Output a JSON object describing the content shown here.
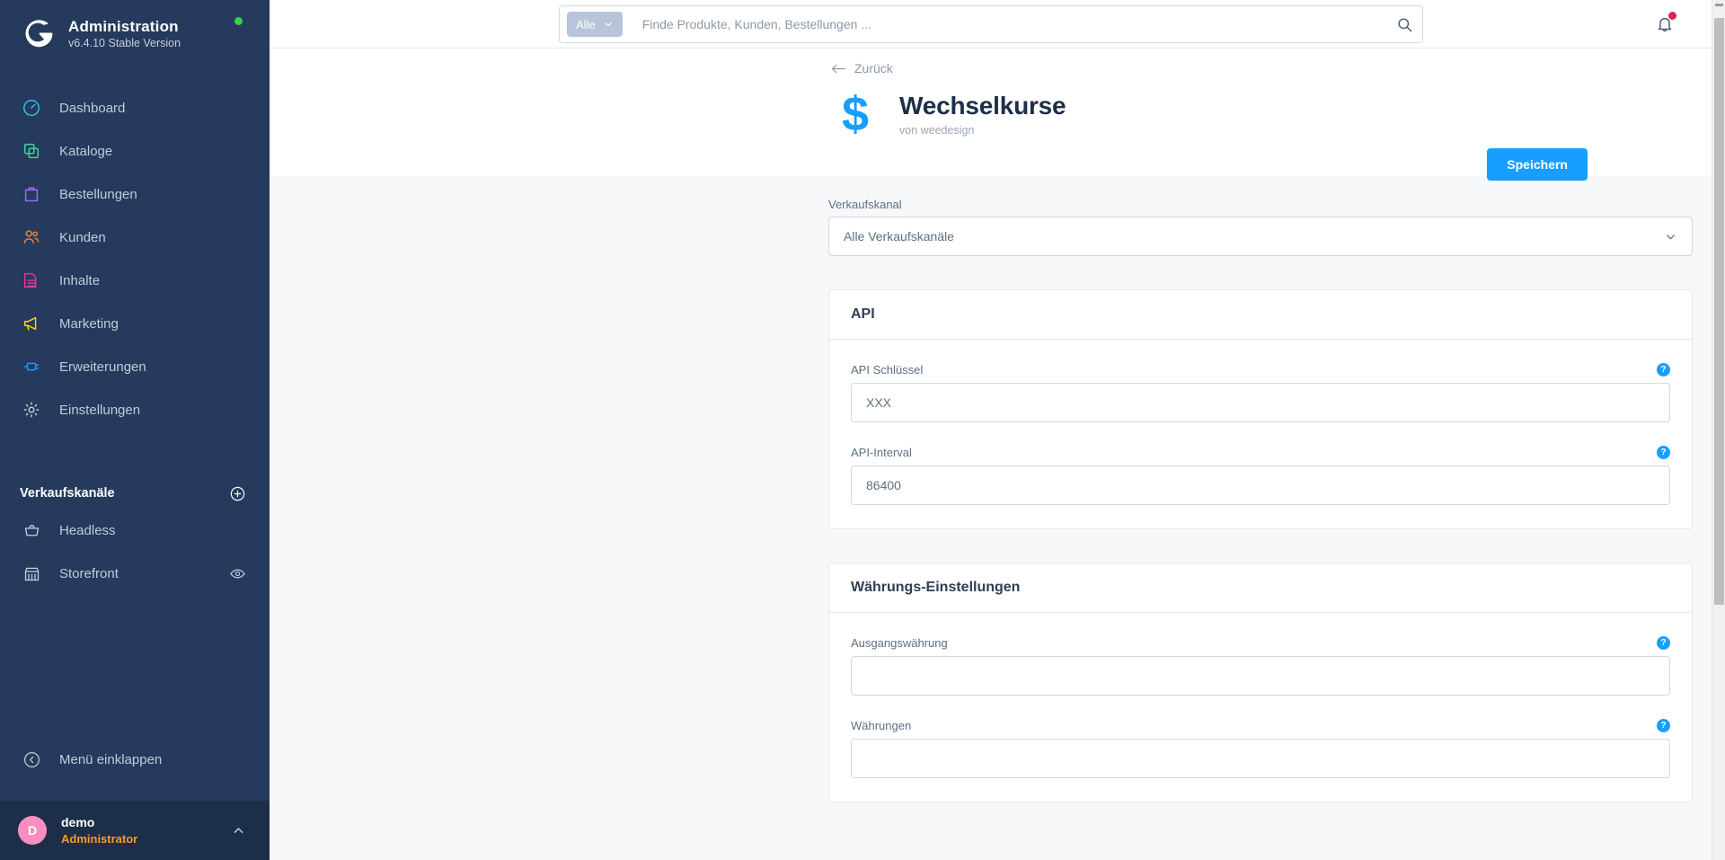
{
  "sidebar": {
    "brand": {
      "title": "Administration",
      "version": "v6.4.10 Stable Version"
    },
    "nav": [
      {
        "label": "Dashboard",
        "icon": "speedometer-icon",
        "color": "#37BFE8"
      },
      {
        "label": "Kataloge",
        "icon": "catalog-icon",
        "color": "#3FD69E"
      },
      {
        "label": "Bestellungen",
        "icon": "bag-icon",
        "color": "#9B6EF3"
      },
      {
        "label": "Kunden",
        "icon": "users-icon",
        "color": "#F1852F"
      },
      {
        "label": "Inhalte",
        "icon": "content-icon",
        "color": "#F0319B"
      },
      {
        "label": "Marketing",
        "icon": "megaphone-icon",
        "color": "#F7D117"
      },
      {
        "label": "Erweiterungen",
        "icon": "plugin-icon",
        "color": "#189EFF"
      },
      {
        "label": "Einstellungen",
        "icon": "gear-icon",
        "color": "#C5CEDC"
      }
    ],
    "sales_channels": {
      "title": "Verkaufskanäle",
      "add_label": "+",
      "items": [
        {
          "label": "Headless",
          "icon": "basket-icon",
          "has_eye": false
        },
        {
          "label": "Storefront",
          "icon": "storefront-icon",
          "has_eye": true
        }
      ]
    },
    "collapse_label": "Menü einklappen",
    "user": {
      "initial": "D",
      "name": "demo",
      "role": "Administrator"
    }
  },
  "topbar": {
    "scope_label": "Alle",
    "search_placeholder": "Finde Produkte, Kunden, Bestellungen ...",
    "search_value": ""
  },
  "header": {
    "back_label": "Zurück",
    "app_symbol": "$",
    "title": "Wechselkurse",
    "subtitle": "von weedesign",
    "save_label": "Speichern"
  },
  "main": {
    "sales_channel": {
      "label": "Verkaufskanal",
      "value": "Alle Verkaufskanäle"
    },
    "cards": [
      {
        "title": "API",
        "fields": [
          {
            "label": "API Schlüssel",
            "value": "XXX",
            "help": "?"
          },
          {
            "label": "API-Interval",
            "value": "86400",
            "help": "?"
          }
        ]
      },
      {
        "title": "Währungs-Einstellungen",
        "fields": [
          {
            "label": "Ausgangswährung",
            "value": "",
            "help": "?"
          },
          {
            "label": "Währungen",
            "value": "",
            "help": "?"
          }
        ]
      }
    ]
  },
  "colors": {
    "sidebar_bg": "#253A5C",
    "accent": "#189EFF",
    "content_bg": "#F7F8FA",
    "admin_role": "#F59B2B",
    "status_dot": "#37D046",
    "notification_dot": "#E1264E"
  }
}
